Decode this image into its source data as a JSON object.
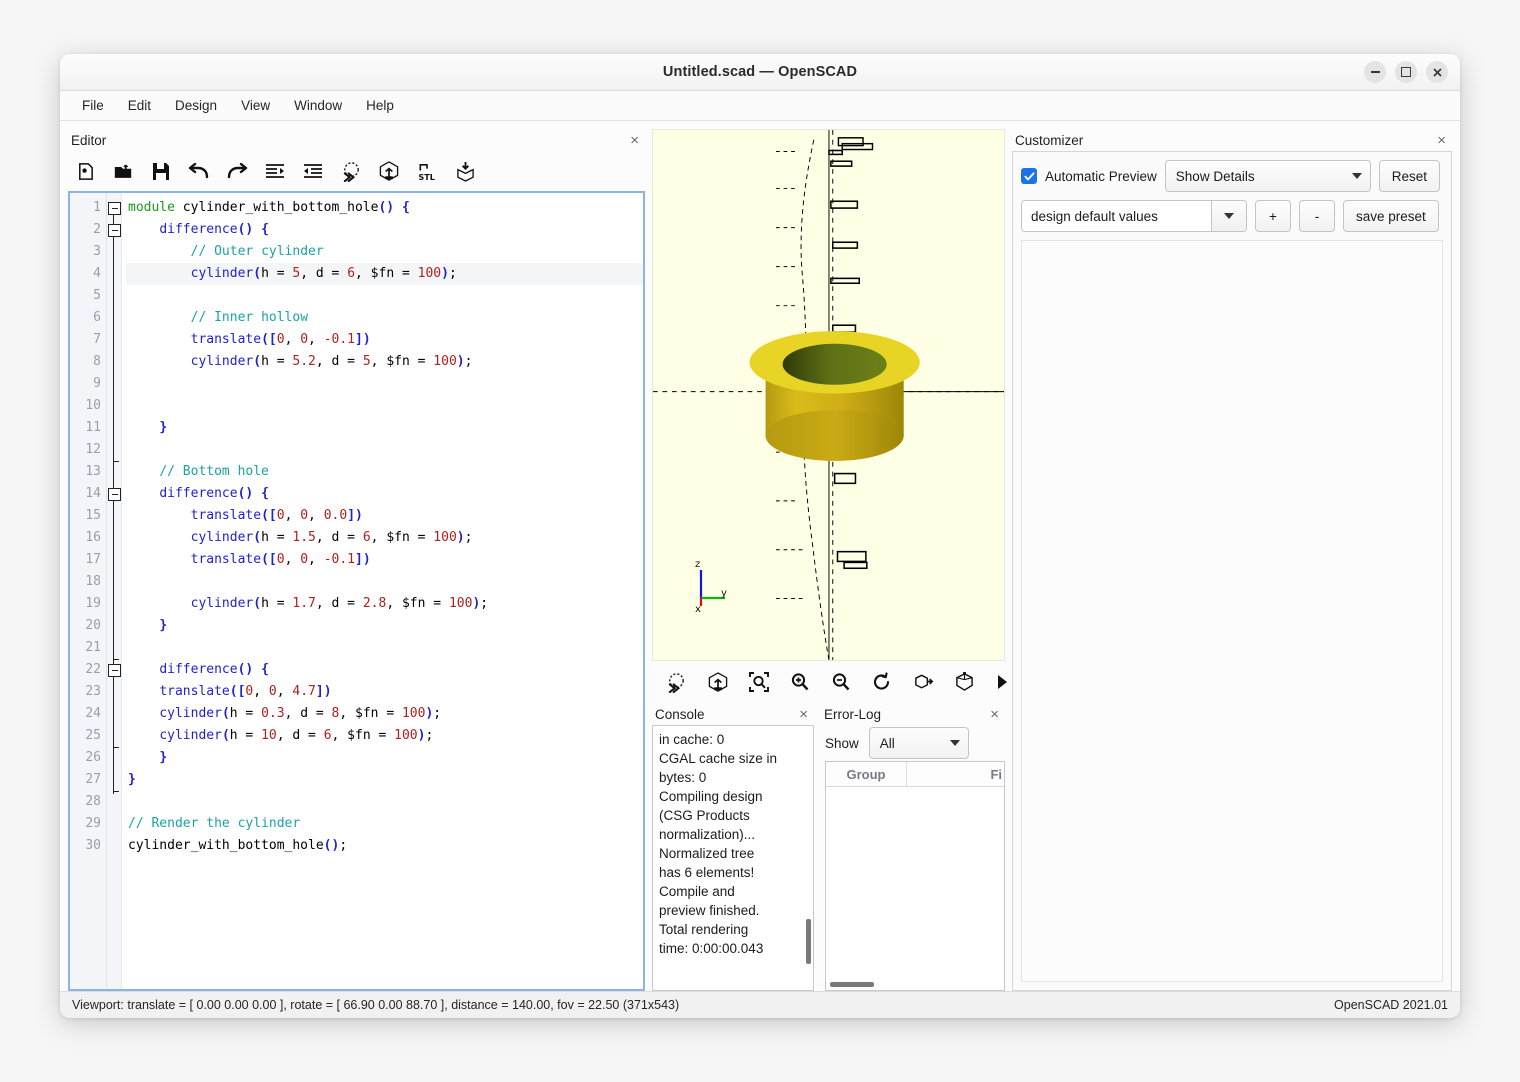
{
  "window": {
    "title": "Untitled.scad — OpenSCAD",
    "minimize_label": "minimize",
    "maximize_label": "maximize",
    "close_label": "close"
  },
  "menubar": {
    "items": [
      {
        "label": "File"
      },
      {
        "label": "Edit"
      },
      {
        "label": "Design"
      },
      {
        "label": "View"
      },
      {
        "label": "Window"
      },
      {
        "label": "Help"
      }
    ]
  },
  "editor": {
    "title": "Editor",
    "close_label": "×",
    "toolbar": [
      {
        "name": "new-file-icon",
        "tooltip": "New"
      },
      {
        "name": "open-file-icon",
        "tooltip": "Open"
      },
      {
        "name": "save-file-icon",
        "tooltip": "Save"
      },
      {
        "name": "undo-icon",
        "tooltip": "Undo"
      },
      {
        "name": "redo-icon",
        "tooltip": "Redo"
      },
      {
        "name": "unindent-icon",
        "tooltip": "Unindent"
      },
      {
        "name": "indent-icon",
        "tooltip": "Indent"
      },
      {
        "name": "preview-icon",
        "tooltip": "Preview"
      },
      {
        "name": "render-icon",
        "tooltip": "Render"
      },
      {
        "name": "export-stl-icon",
        "tooltip": "Export as STL"
      },
      {
        "name": "send-to-printer-icon",
        "tooltip": "Send to print service"
      }
    ],
    "current_line": 4,
    "lines": [
      {
        "n": 1,
        "tokens": [
          {
            "t": "module",
            "c": "kw"
          },
          {
            "t": " cylinder_with_bottom_hole",
            "c": "fn"
          },
          {
            "t": "()",
            "c": "br"
          },
          {
            "t": " ",
            "c": "id"
          },
          {
            "t": "{",
            "c": "br"
          }
        ]
      },
      {
        "n": 2,
        "tokens": [
          {
            "t": "    ",
            "c": "id"
          },
          {
            "t": "difference",
            "c": "bi"
          },
          {
            "t": "()",
            "c": "br"
          },
          {
            "t": " ",
            "c": "id"
          },
          {
            "t": "{",
            "c": "br"
          }
        ]
      },
      {
        "n": 3,
        "tokens": [
          {
            "t": "        ",
            "c": "id"
          },
          {
            "t": "// Outer cylinder",
            "c": "cm"
          }
        ]
      },
      {
        "n": 4,
        "tokens": [
          {
            "t": "        ",
            "c": "id"
          },
          {
            "t": "cylinder",
            "c": "bi"
          },
          {
            "t": "(",
            "c": "br"
          },
          {
            "t": "h = ",
            "c": "id"
          },
          {
            "t": "5",
            "c": "num"
          },
          {
            "t": ", d = ",
            "c": "id"
          },
          {
            "t": "6",
            "c": "num"
          },
          {
            "t": ", $fn = ",
            "c": "id"
          },
          {
            "t": "100",
            "c": "num"
          },
          {
            "t": ")",
            "c": "br"
          },
          {
            "t": ";",
            "c": "id"
          }
        ]
      },
      {
        "n": 5,
        "tokens": []
      },
      {
        "n": 6,
        "tokens": [
          {
            "t": "        ",
            "c": "id"
          },
          {
            "t": "// Inner hollow",
            "c": "cm"
          }
        ]
      },
      {
        "n": 7,
        "tokens": [
          {
            "t": "        ",
            "c": "id"
          },
          {
            "t": "translate",
            "c": "bi"
          },
          {
            "t": "(",
            "c": "br"
          },
          {
            "t": "[",
            "c": "br"
          },
          {
            "t": "0",
            "c": "num"
          },
          {
            "t": ", ",
            "c": "id"
          },
          {
            "t": "0",
            "c": "num"
          },
          {
            "t": ", ",
            "c": "id"
          },
          {
            "t": "-0.1",
            "c": "num"
          },
          {
            "t": "]",
            "c": "br"
          },
          {
            "t": ")",
            "c": "br"
          }
        ]
      },
      {
        "n": 8,
        "tokens": [
          {
            "t": "        ",
            "c": "id"
          },
          {
            "t": "cylinder",
            "c": "bi"
          },
          {
            "t": "(",
            "c": "br"
          },
          {
            "t": "h = ",
            "c": "id"
          },
          {
            "t": "5.2",
            "c": "num"
          },
          {
            "t": ", d = ",
            "c": "id"
          },
          {
            "t": "5",
            "c": "num"
          },
          {
            "t": ", $fn = ",
            "c": "id"
          },
          {
            "t": "100",
            "c": "num"
          },
          {
            "t": ")",
            "c": "br"
          },
          {
            "t": ";",
            "c": "id"
          }
        ]
      },
      {
        "n": 9,
        "tokens": []
      },
      {
        "n": 10,
        "tokens": []
      },
      {
        "n": 11,
        "tokens": [
          {
            "t": "    ",
            "c": "id"
          },
          {
            "t": "}",
            "c": "br"
          }
        ]
      },
      {
        "n": 12,
        "tokens": []
      },
      {
        "n": 13,
        "tokens": [
          {
            "t": "    ",
            "c": "id"
          },
          {
            "t": "// Bottom hole",
            "c": "cm"
          }
        ]
      },
      {
        "n": 14,
        "tokens": [
          {
            "t": "    ",
            "c": "id"
          },
          {
            "t": "difference",
            "c": "bi"
          },
          {
            "t": "()",
            "c": "br"
          },
          {
            "t": " ",
            "c": "id"
          },
          {
            "t": "{",
            "c": "br"
          }
        ]
      },
      {
        "n": 15,
        "tokens": [
          {
            "t": "        ",
            "c": "id"
          },
          {
            "t": "translate",
            "c": "bi"
          },
          {
            "t": "(",
            "c": "br"
          },
          {
            "t": "[",
            "c": "br"
          },
          {
            "t": "0",
            "c": "num"
          },
          {
            "t": ", ",
            "c": "id"
          },
          {
            "t": "0",
            "c": "num"
          },
          {
            "t": ", ",
            "c": "id"
          },
          {
            "t": "0.0",
            "c": "num"
          },
          {
            "t": "]",
            "c": "br"
          },
          {
            "t": ")",
            "c": "br"
          }
        ]
      },
      {
        "n": 16,
        "tokens": [
          {
            "t": "        ",
            "c": "id"
          },
          {
            "t": "cylinder",
            "c": "bi"
          },
          {
            "t": "(",
            "c": "br"
          },
          {
            "t": "h = ",
            "c": "id"
          },
          {
            "t": "1.5",
            "c": "num"
          },
          {
            "t": ", d = ",
            "c": "id"
          },
          {
            "t": "6",
            "c": "num"
          },
          {
            "t": ", $fn = ",
            "c": "id"
          },
          {
            "t": "100",
            "c": "num"
          },
          {
            "t": ")",
            "c": "br"
          },
          {
            "t": ";",
            "c": "id"
          }
        ]
      },
      {
        "n": 17,
        "tokens": [
          {
            "t": "        ",
            "c": "id"
          },
          {
            "t": "translate",
            "c": "bi"
          },
          {
            "t": "(",
            "c": "br"
          },
          {
            "t": "[",
            "c": "br"
          },
          {
            "t": "0",
            "c": "num"
          },
          {
            "t": ", ",
            "c": "id"
          },
          {
            "t": "0",
            "c": "num"
          },
          {
            "t": ", ",
            "c": "id"
          },
          {
            "t": "-0.1",
            "c": "num"
          },
          {
            "t": "]",
            "c": "br"
          },
          {
            "t": ")",
            "c": "br"
          }
        ]
      },
      {
        "n": 18,
        "tokens": []
      },
      {
        "n": 19,
        "tokens": [
          {
            "t": "        ",
            "c": "id"
          },
          {
            "t": "cylinder",
            "c": "bi"
          },
          {
            "t": "(",
            "c": "br"
          },
          {
            "t": "h = ",
            "c": "id"
          },
          {
            "t": "1.7",
            "c": "num"
          },
          {
            "t": ", d = ",
            "c": "id"
          },
          {
            "t": "2.8",
            "c": "num"
          },
          {
            "t": ", $fn = ",
            "c": "id"
          },
          {
            "t": "100",
            "c": "num"
          },
          {
            "t": ")",
            "c": "br"
          },
          {
            "t": ";",
            "c": "id"
          }
        ]
      },
      {
        "n": 20,
        "tokens": [
          {
            "t": "    ",
            "c": "id"
          },
          {
            "t": "}",
            "c": "br"
          }
        ]
      },
      {
        "n": 21,
        "tokens": []
      },
      {
        "n": 22,
        "tokens": [
          {
            "t": "    ",
            "c": "id"
          },
          {
            "t": "difference",
            "c": "bi"
          },
          {
            "t": "()",
            "c": "br"
          },
          {
            "t": " ",
            "c": "id"
          },
          {
            "t": "{",
            "c": "br"
          }
        ]
      },
      {
        "n": 23,
        "tokens": [
          {
            "t": "    ",
            "c": "id"
          },
          {
            "t": "translate",
            "c": "bi"
          },
          {
            "t": "(",
            "c": "br"
          },
          {
            "t": "[",
            "c": "br"
          },
          {
            "t": "0",
            "c": "num"
          },
          {
            "t": ", ",
            "c": "id"
          },
          {
            "t": "0",
            "c": "num"
          },
          {
            "t": ", ",
            "c": "id"
          },
          {
            "t": "4.7",
            "c": "num"
          },
          {
            "t": "]",
            "c": "br"
          },
          {
            "t": ")",
            "c": "br"
          }
        ]
      },
      {
        "n": 24,
        "tokens": [
          {
            "t": "    ",
            "c": "id"
          },
          {
            "t": "cylinder",
            "c": "bi"
          },
          {
            "t": "(",
            "c": "br"
          },
          {
            "t": "h = ",
            "c": "id"
          },
          {
            "t": "0.3",
            "c": "num"
          },
          {
            "t": ", d = ",
            "c": "id"
          },
          {
            "t": "8",
            "c": "num"
          },
          {
            "t": ", $fn = ",
            "c": "id"
          },
          {
            "t": "100",
            "c": "num"
          },
          {
            "t": ")",
            "c": "br"
          },
          {
            "t": ";",
            "c": "id"
          }
        ]
      },
      {
        "n": 25,
        "tokens": [
          {
            "t": "    ",
            "c": "id"
          },
          {
            "t": "cylinder",
            "c": "bi"
          },
          {
            "t": "(",
            "c": "br"
          },
          {
            "t": "h = ",
            "c": "id"
          },
          {
            "t": "10",
            "c": "num"
          },
          {
            "t": ", d = ",
            "c": "id"
          },
          {
            "t": "6",
            "c": "num"
          },
          {
            "t": ", $fn = ",
            "c": "id"
          },
          {
            "t": "100",
            "c": "num"
          },
          {
            "t": ")",
            "c": "br"
          },
          {
            "t": ";",
            "c": "id"
          }
        ]
      },
      {
        "n": 26,
        "tokens": [
          {
            "t": "    ",
            "c": "id"
          },
          {
            "t": "}",
            "c": "br"
          }
        ]
      },
      {
        "n": 27,
        "tokens": [
          {
            "t": "}",
            "c": "br"
          }
        ]
      },
      {
        "n": 28,
        "tokens": []
      },
      {
        "n": 29,
        "tokens": [
          {
            "t": "// Render the cylinder",
            "c": "cm"
          }
        ]
      },
      {
        "n": 30,
        "tokens": [
          {
            "t": "cylinder_with_bottom_hole",
            "c": "fn"
          },
          {
            "t": "()",
            "c": "br"
          },
          {
            "t": ";",
            "c": "id"
          }
        ]
      }
    ]
  },
  "viewport": {
    "axis_labels": {
      "x": "x",
      "y": "y",
      "z": "z"
    },
    "model_color_top": "#e8d424",
    "model_color_side": "#c9ab15",
    "model_color_bore": "#4f5e12",
    "background": "#ffffe5",
    "toolbar": [
      {
        "name": "preview-icon",
        "tooltip": "Preview"
      },
      {
        "name": "render-icon",
        "tooltip": "Render"
      },
      {
        "name": "zoom-fit-icon",
        "tooltip": "View All"
      },
      {
        "name": "zoom-in-icon",
        "tooltip": "Zoom In"
      },
      {
        "name": "zoom-out-icon",
        "tooltip": "Zoom Out"
      },
      {
        "name": "reset-view-icon",
        "tooltip": "Reset View"
      },
      {
        "name": "view-right-icon",
        "tooltip": "Right View"
      },
      {
        "name": "view-diagonal-icon",
        "tooltip": "Diagonal View"
      },
      {
        "name": "toolbar-overflow-icon",
        "tooltip": "More"
      }
    ]
  },
  "console": {
    "title": "Console",
    "close_label": "×",
    "lines": [
      "in cache: 0",
      "CGAL cache size in",
      "bytes: 0",
      "Compiling design",
      "(CSG Products",
      "normalization)...",
      "Normalized tree",
      "has 6 elements!",
      "Compile and",
      "preview finished.",
      "Total rendering",
      "time: 0:00:00.043"
    ]
  },
  "errorlog": {
    "title": "Error-Log",
    "close_label": "×",
    "show_label": "Show",
    "filter_value": "All",
    "columns": [
      "Group",
      "Fi"
    ],
    "rows": []
  },
  "customizer": {
    "title": "Customizer",
    "close_label": "×",
    "automatic_preview_label": "Automatic Preview",
    "automatic_preview_checked": true,
    "details_value": "Show Details",
    "reset_label": "Reset",
    "preset_value": "design default values",
    "add_label": "+",
    "remove_label": "-",
    "save_preset_label": "save preset"
  },
  "statusbar": {
    "left": "Viewport: translate = [ 0.00 0.00 0.00 ], rotate = [ 66.90 0.00 88.70 ], distance = 140.00, fov = 22.50 (371x543)",
    "right": "OpenSCAD 2021.01"
  }
}
